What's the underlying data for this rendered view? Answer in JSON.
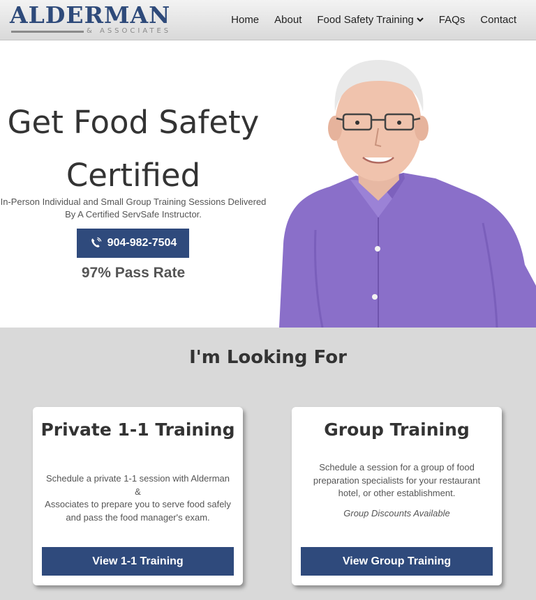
{
  "header": {
    "logo": {
      "name": "ALDERMAN",
      "sub": "& ASSOCIATES"
    },
    "nav": [
      {
        "label": "Home"
      },
      {
        "label": "About"
      },
      {
        "label": "Food Safety Training"
      },
      {
        "label": "FAQs"
      },
      {
        "label": "Contact"
      }
    ]
  },
  "hero": {
    "title_line1": "Get Food Safety",
    "title_line2": "Certified",
    "subtitle_line1": "In-Person Individual and Small Group Training Sessions Delivered",
    "subtitle_line2": "By A Certified ServSafe Instructor.",
    "phone": "904-982-7504",
    "pass_rate": "97% Pass Rate"
  },
  "looking": {
    "title": "I'm Looking For",
    "cards": [
      {
        "title": "Private 1-1 Training",
        "desc_lines": [
          "Schedule a private 1-1 session with Alderman &",
          "Associates to prepare you to serve food safely",
          "and pass the food manager's exam."
        ],
        "button": "View 1-1 Training"
      },
      {
        "title": "Group Training",
        "desc_lines": [
          "Schedule a session for a group of food",
          "preparation specialists for your restaurant",
          "hotel, or other establishment."
        ],
        "note": "Group Discounts Available",
        "button": "View Group Training"
      }
    ]
  },
  "colors": {
    "brand": "#2f4a7c",
    "section_bg": "#d9d9d9"
  },
  "icons": {
    "phone": "phone-icon",
    "dropdown": "chevron-down-icon",
    "portrait": "instructor-photo"
  }
}
